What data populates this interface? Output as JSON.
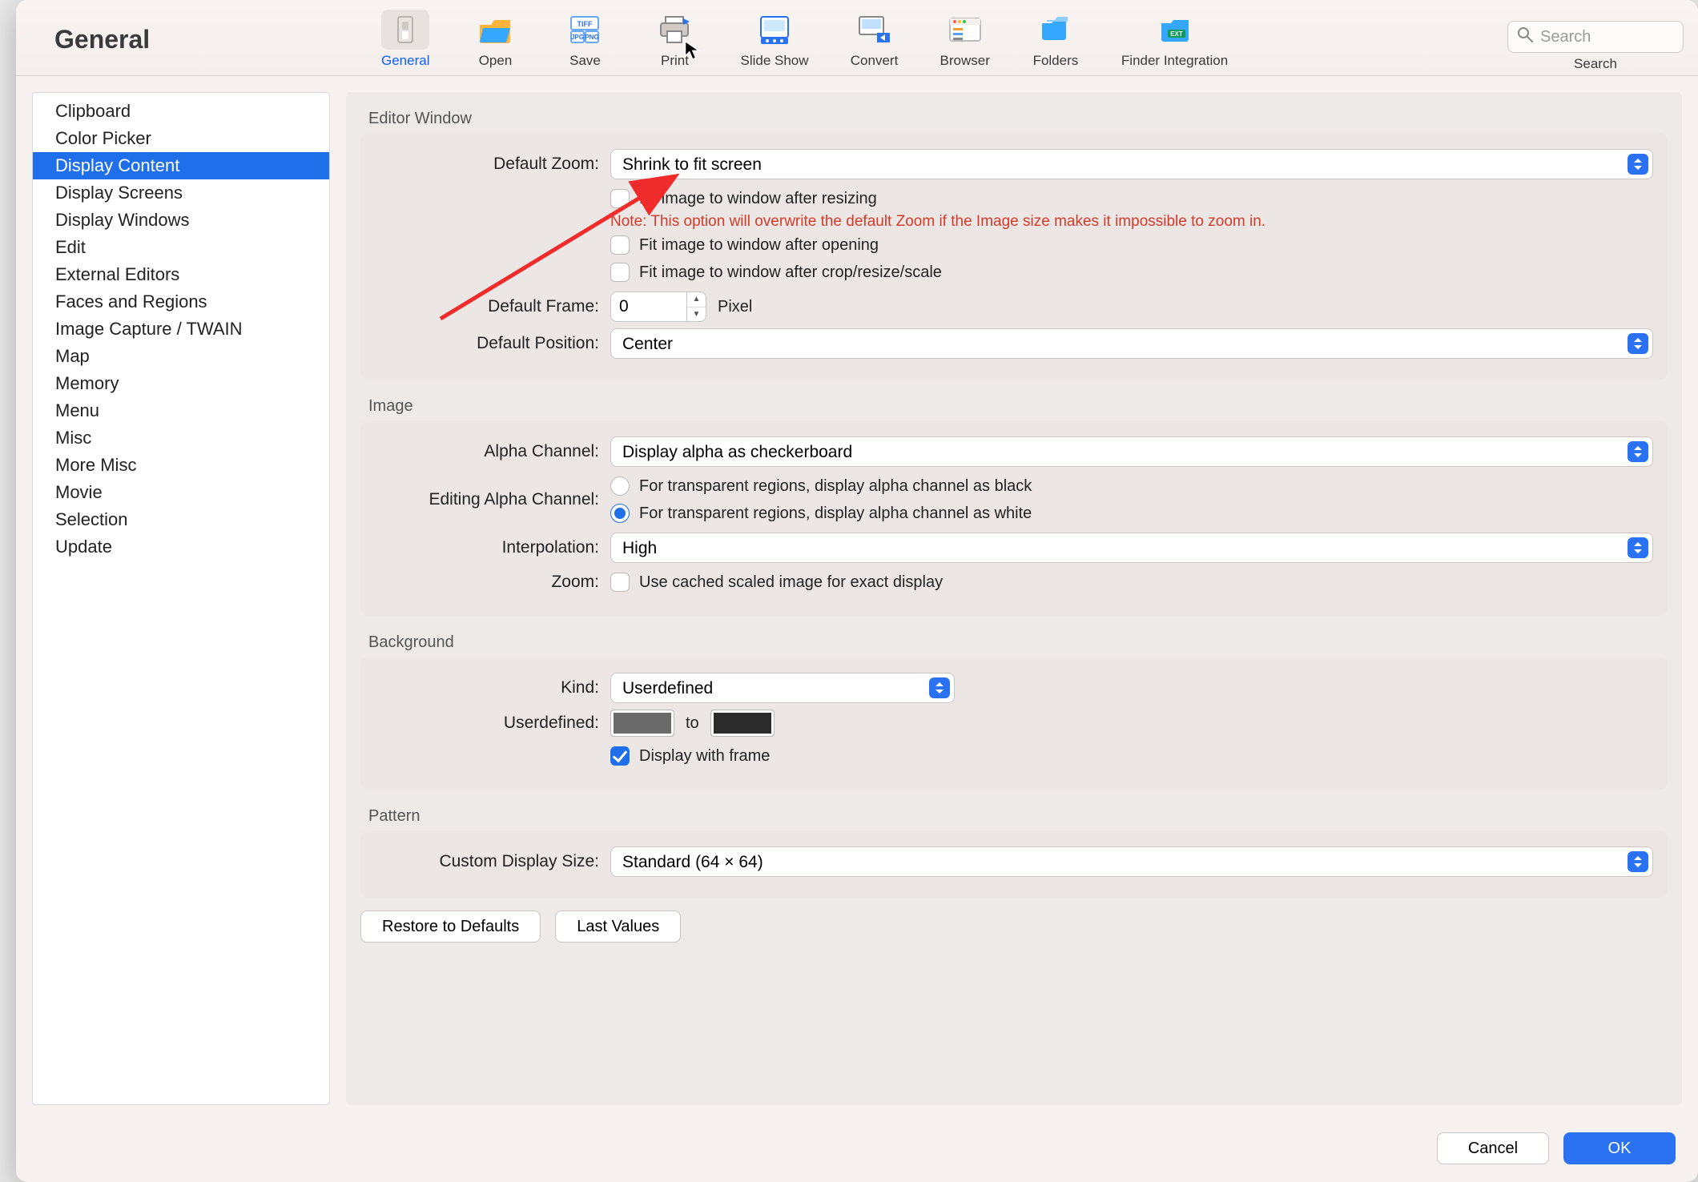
{
  "window": {
    "title": "General"
  },
  "toolbar": {
    "items": [
      {
        "label": "General",
        "selected": true
      },
      {
        "label": "Open",
        "selected": false
      },
      {
        "label": "Save",
        "selected": false
      },
      {
        "label": "Print",
        "selected": false
      },
      {
        "label": "Slide Show",
        "selected": false
      },
      {
        "label": "Convert",
        "selected": false
      },
      {
        "label": "Browser",
        "selected": false
      },
      {
        "label": "Folders",
        "selected": false
      },
      {
        "label": "Finder Integration",
        "selected": false
      }
    ],
    "search": {
      "placeholder": "Search",
      "label": "Search"
    }
  },
  "sidebar": {
    "items": [
      "Clipboard",
      "Color Picker",
      "Display Content",
      "Display Screens",
      "Display Windows",
      "Edit",
      "External Editors",
      "Faces and Regions",
      "Image Capture / TWAIN",
      "Map",
      "Memory",
      "Menu",
      "Misc",
      "More Misc",
      "Movie",
      "Selection",
      "Update"
    ],
    "selected_index": 2
  },
  "groups": {
    "editor_window": {
      "title": "Editor Window",
      "default_zoom_label": "Default Zoom:",
      "default_zoom_value": "Shrink to fit screen",
      "fit_resize": {
        "label": "Fit image to window after resizing",
        "checked": false
      },
      "fit_resize_note": "Note: This option will overwrite the default Zoom if the Image size makes it impossible to zoom in.",
      "fit_open": {
        "label": "Fit image to window after opening",
        "checked": false
      },
      "fit_crop": {
        "label": "Fit image to window after crop/resize/scale",
        "checked": false
      },
      "default_frame_label": "Default Frame:",
      "default_frame_value": "0",
      "default_frame_unit": "Pixel",
      "default_position_label": "Default Position:",
      "default_position_value": "Center"
    },
    "image": {
      "title": "Image",
      "alpha_channel_label": "Alpha Channel:",
      "alpha_channel_value": "Display alpha as checkerboard",
      "editing_alpha_label": "Editing Alpha Channel:",
      "alpha_black": "For transparent regions, display alpha channel as black",
      "alpha_white": "For transparent regions, display alpha channel as white",
      "alpha_selected": "white",
      "interpolation_label": "Interpolation:",
      "interpolation_value": "High",
      "zoom_label": "Zoom:",
      "zoom_cache": {
        "label": "Use cached scaled image for exact display",
        "checked": false
      }
    },
    "background": {
      "title": "Background",
      "kind_label": "Kind:",
      "kind_value": "Userdefined",
      "userdefined_label": "Userdefined:",
      "to_label": "to",
      "display_frame": {
        "label": "Display with frame",
        "checked": true
      }
    },
    "pattern": {
      "title": "Pattern",
      "custom_size_label": "Custom Display Size:",
      "custom_size_value": "Standard (64 × 64)"
    }
  },
  "buttons": {
    "restore": "Restore to Defaults",
    "last": "Last Values",
    "cancel": "Cancel",
    "ok": "OK"
  }
}
